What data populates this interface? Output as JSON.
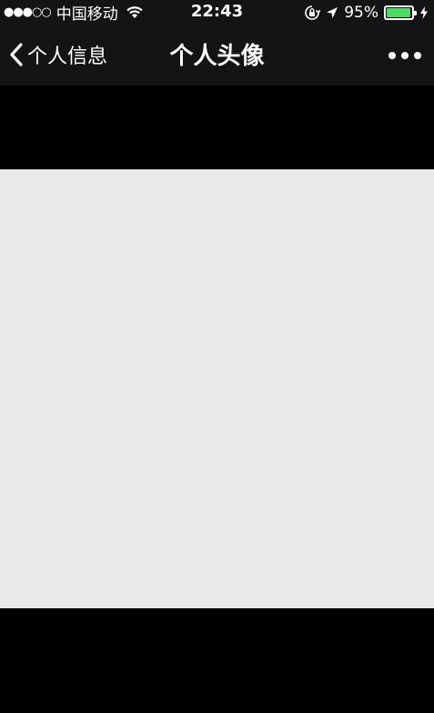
{
  "status_bar": {
    "signal": "●●●○○",
    "carrier": "中国移动",
    "time": "22:43",
    "battery_percent": "95%",
    "battery_level": 0.95,
    "icons": [
      "wifi-icon",
      "orientation-lock-icon",
      "location-arrow-icon",
      "battery-icon",
      "charging-bolt-icon"
    ]
  },
  "nav": {
    "back_label": "个人信息",
    "title": "个人头像",
    "icons": [
      "back-chevron-icon",
      "more-dots-icon"
    ]
  },
  "colors": {
    "bar_background": "#141416",
    "page_background": "#000000",
    "avatar_placeholder": "#ebe9ec",
    "battery_green": "#4cd964"
  }
}
